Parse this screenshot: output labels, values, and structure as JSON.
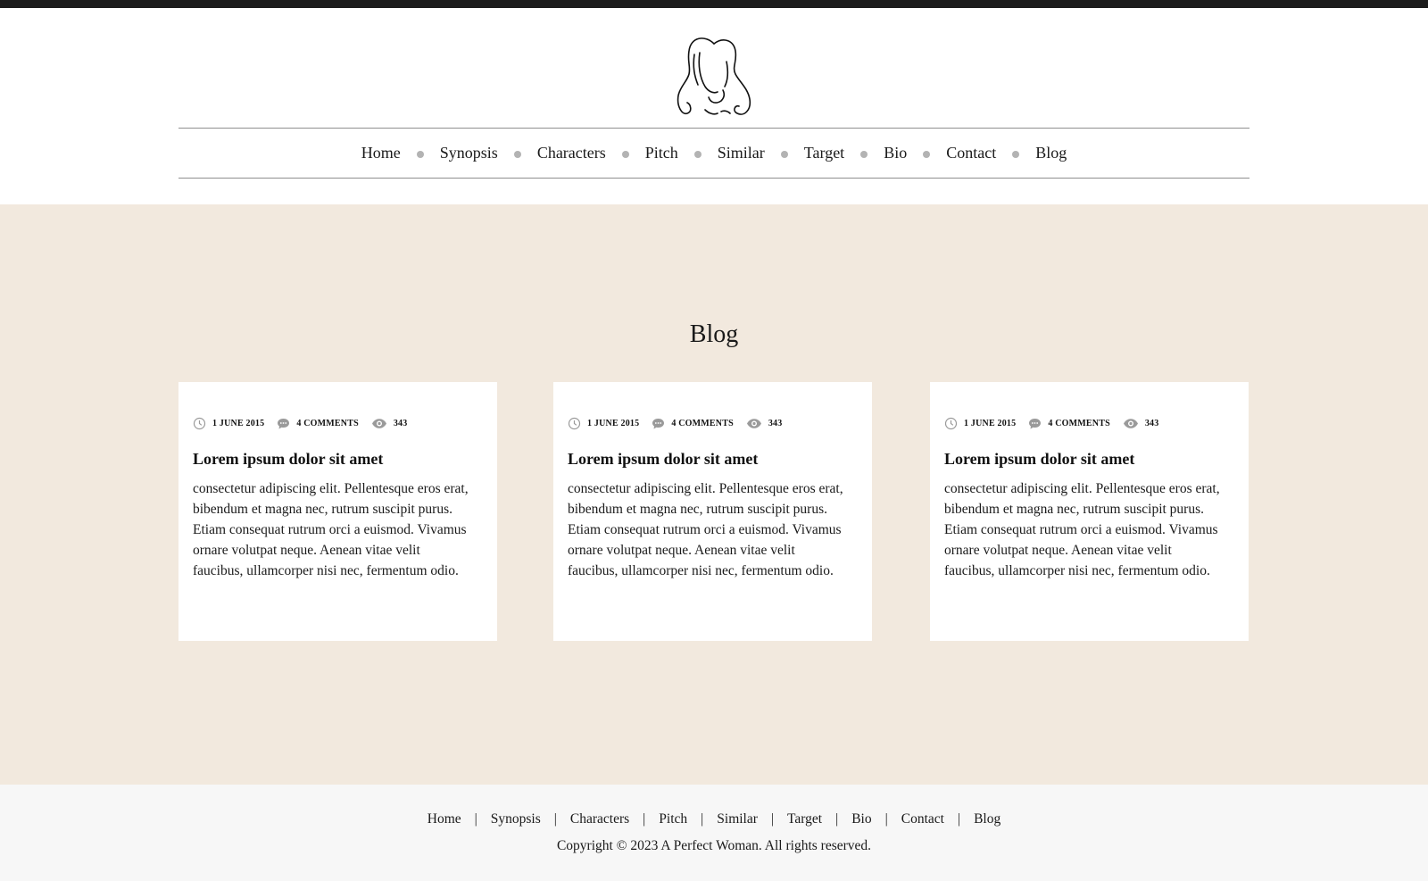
{
  "nav": {
    "items": [
      "Home",
      "Synopsis",
      "Characters",
      "Pitch",
      "Similar",
      "Target",
      "Bio",
      "Contact",
      "Blog"
    ]
  },
  "main": {
    "title": "Blog",
    "posts": [
      {
        "date": "1 JUNE 2015",
        "comments": "4 COMMENTS",
        "views": "343",
        "title": "Lorem ipsum dolor sit amet",
        "body": "consectetur adipiscing elit. Pellentesque eros erat, bibendum et magna nec, rutrum suscipit purus. Etiam consequat rutrum orci a euismod. Vivamus ornare volutpat neque. Aenean vitae velit faucibus, ullamcorper nisi nec, fermentum odio."
      },
      {
        "date": "1 JUNE 2015",
        "comments": "4 COMMENTS",
        "views": "343",
        "title": "Lorem ipsum dolor sit amet",
        "body": "consectetur adipiscing elit. Pellentesque eros erat, bibendum et magna nec, rutrum suscipit purus. Etiam consequat rutrum orci a euismod. Vivamus ornare volutpat neque. Aenean vitae velit faucibus, ullamcorper nisi nec, fermentum odio."
      },
      {
        "date": "1 JUNE 2015",
        "comments": "4 COMMENTS",
        "views": "343",
        "title": "Lorem ipsum dolor sit amet",
        "body": "consectetur adipiscing elit. Pellentesque eros erat, bibendum et magna nec, rutrum suscipit purus. Etiam consequat rutrum orci a euismod. Vivamus ornare volutpat neque. Aenean vitae velit faucibus, ullamcorper nisi nec, fermentum odio."
      }
    ]
  },
  "footer": {
    "items": [
      "Home",
      "Synopsis",
      "Characters",
      "Pitch",
      "Similar",
      "Target",
      "Bio",
      "Contact",
      "Blog"
    ],
    "separator": "|",
    "copyright": "Copyright © 2023 A Perfect Woman. All rights reserved."
  },
  "icons": {
    "logo": "woman-silhouette-logo",
    "date": "clock-icon",
    "comments": "comment-bubble-icon",
    "views": "eye-icon"
  },
  "colors": {
    "topbar": "#1c1c1c",
    "main_background": "#f2e9de",
    "footer_background": "#f7f7f7",
    "nav_dot": "#b3b3b3"
  }
}
